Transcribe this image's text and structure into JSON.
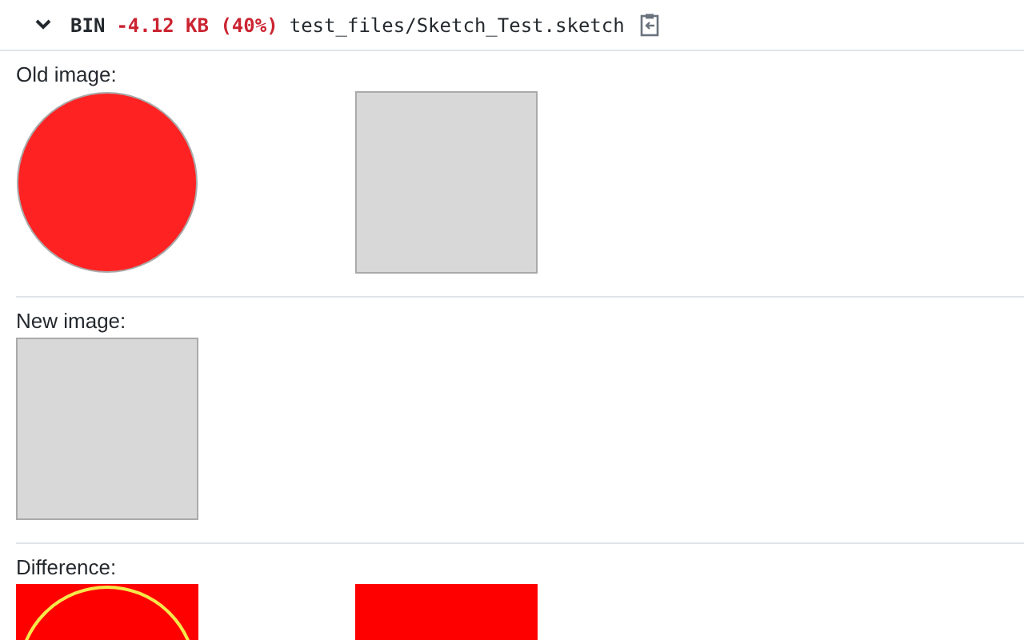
{
  "file_header": {
    "type": "BIN",
    "size_change": "-4.12 KB (40%)",
    "path": "test_files/Sketch_Test.sketch"
  },
  "sections": [
    {
      "label": "Old image:",
      "images": [
        {
          "kind": "circle"
        },
        {
          "kind": "blank"
        }
      ]
    },
    {
      "label": "New image:",
      "images": [
        {
          "kind": "blank"
        }
      ]
    },
    {
      "label": "Difference:",
      "images": [
        {
          "kind": "diff-circle"
        },
        {
          "kind": "diff-fill"
        }
      ]
    }
  ]
}
